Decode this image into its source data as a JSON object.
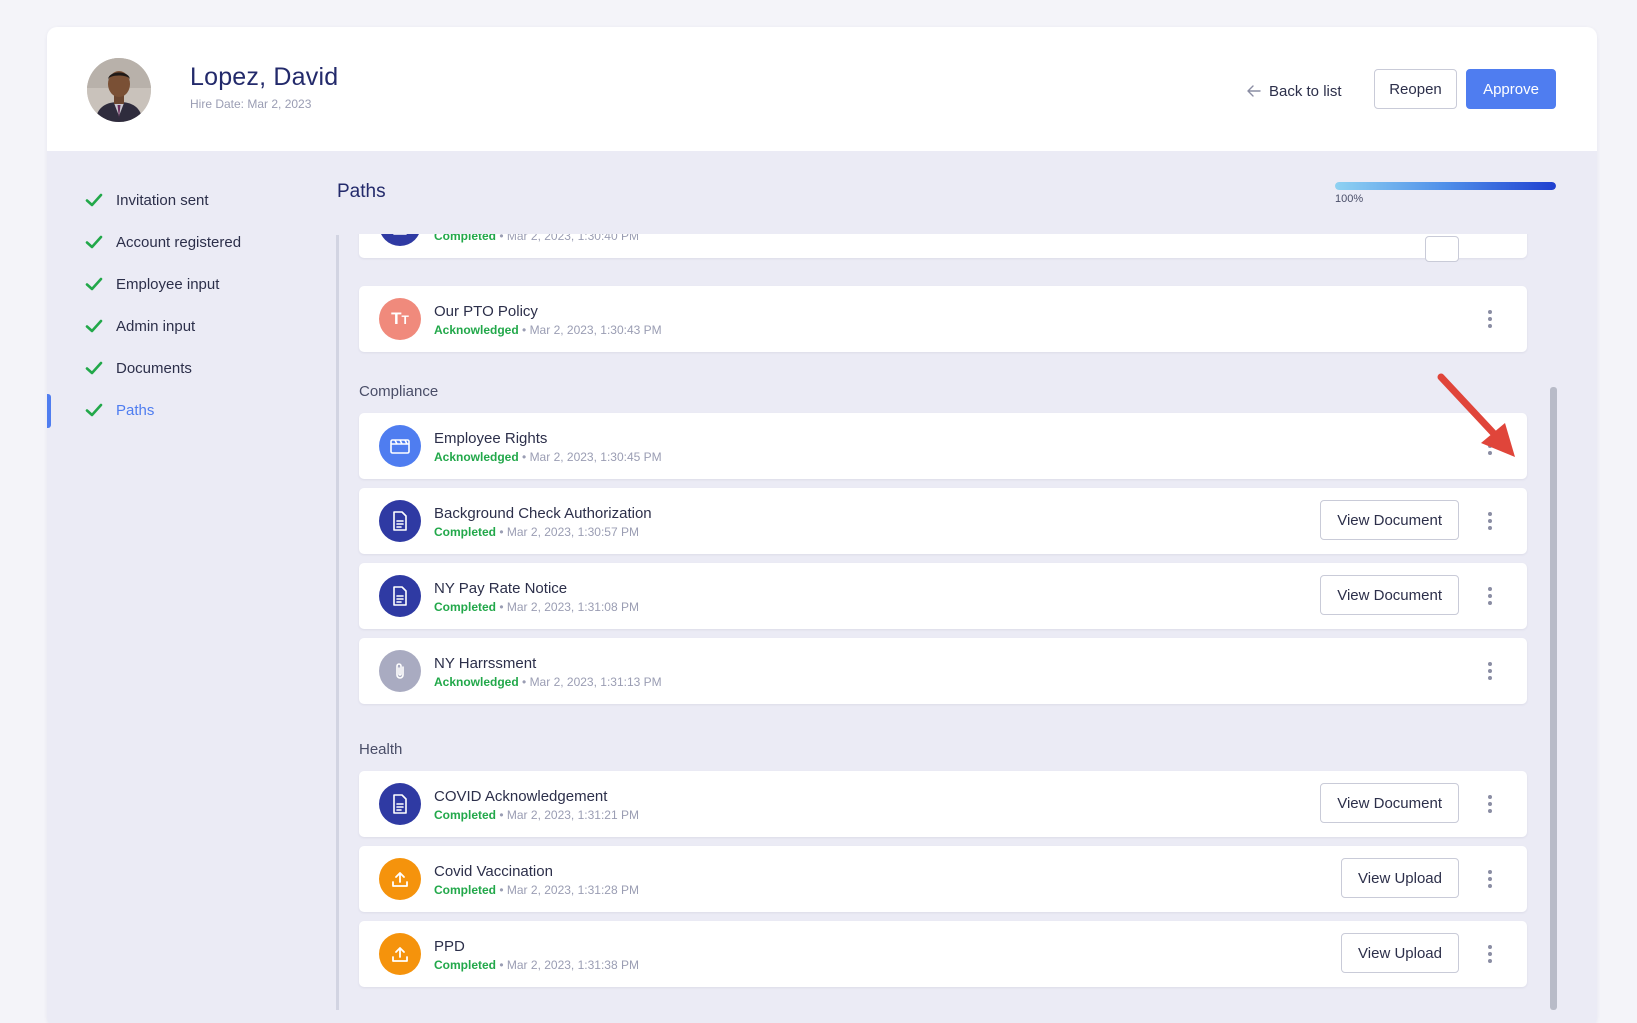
{
  "employee": {
    "name": "Lopez, David",
    "hire_date": "Hire Date: Mar 2, 2023"
  },
  "header": {
    "back_label": "Back to list",
    "reopen_label": "Reopen",
    "approve_label": "Approve"
  },
  "steps": [
    {
      "label": "Invitation sent"
    },
    {
      "label": "Account registered"
    },
    {
      "label": "Employee input"
    },
    {
      "label": "Admin input"
    },
    {
      "label": "Documents"
    },
    {
      "label": "Paths"
    }
  ],
  "paths": {
    "title": "Paths",
    "progress": 1.0,
    "progress_label": "100%"
  },
  "items": [
    {
      "title": "",
      "status": "Completed",
      "timestamp": "Mar 2, 2023, 1:30:40 PM",
      "icon": "document-icon",
      "icon_color": "#2f3aa3",
      "action": ""
    },
    {
      "title": "Our PTO Policy",
      "status": "Acknowledged",
      "timestamp": "Mar 2, 2023, 1:30:43 PM",
      "icon": "text-icon",
      "icon_color": "#f08a7c",
      "action": ""
    },
    {
      "title": "Employee Rights",
      "status": "Acknowledged",
      "timestamp": "Mar 2, 2023, 1:30:45 PM",
      "icon": "video-icon",
      "icon_color": "#4f7df0",
      "action": ""
    },
    {
      "title": "Background Check Authorization",
      "status": "Completed",
      "timestamp": "Mar 2, 2023, 1:30:57 PM",
      "icon": "document-icon",
      "icon_color": "#2f3aa3",
      "action": "View Document"
    },
    {
      "title": "NY Pay Rate Notice",
      "status": "Completed",
      "timestamp": "Mar 2, 2023, 1:31:08 PM",
      "icon": "document-icon",
      "icon_color": "#2f3aa3",
      "action": "View Document"
    },
    {
      "title": "NY Harrssment",
      "status": "Acknowledged",
      "timestamp": "Mar 2, 2023, 1:31:13 PM",
      "icon": "paperclip-icon",
      "icon_color": "#a9abc1",
      "action": ""
    },
    {
      "title": "COVID Acknowledgement",
      "status": "Completed",
      "timestamp": "Mar 2, 2023, 1:31:21 PM",
      "icon": "document-icon",
      "icon_color": "#2f3aa3",
      "action": "View Document"
    },
    {
      "title": "Covid Vaccination",
      "status": "Completed",
      "timestamp": "Mar 2, 2023, 1:31:28 PM",
      "icon": "upload-icon",
      "icon_color": "#f5930c",
      "action": "View Upload"
    },
    {
      "title": "PPD",
      "status": "Completed",
      "timestamp": "Mar 2, 2023, 1:31:38 PM",
      "icon": "upload-icon",
      "icon_color": "#f5930c",
      "action": "View Upload"
    }
  ],
  "groups": [
    {
      "label": "Compliance"
    },
    {
      "label": "Health"
    }
  ],
  "colors": {
    "accent": "#4f7df0",
    "success": "#22a84a",
    "annotation_arrow": "#e0453a"
  }
}
